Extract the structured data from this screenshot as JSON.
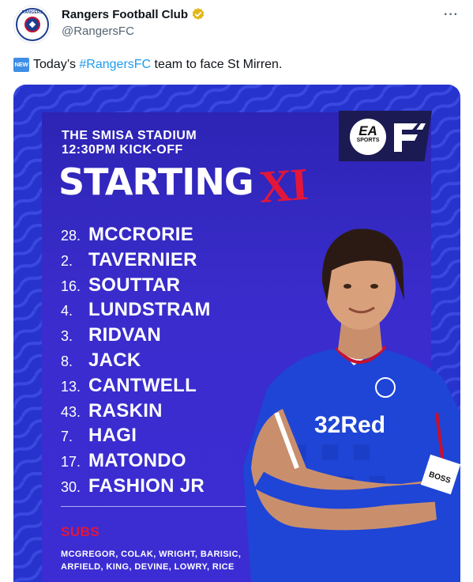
{
  "tweet": {
    "display_name": "Rangers Football Club",
    "handle": "@RangersFC",
    "more_label": "···",
    "avatar_text": "RANGERS",
    "new_badge": "NEW",
    "text_before": "Today’s ",
    "hashtag": "#RangersFC",
    "text_after": " team to face St Mirren."
  },
  "graphic": {
    "stadium": "THE SMISA STADIUM",
    "kickoff": "12:30PM KICK-OFF",
    "starting": "STARTING",
    "xi": "XI",
    "ea_logo": "EA",
    "ea_sports": "SPORTS",
    "shirt_sponsor": "32Red",
    "sleeve_sponsor": "BOSS",
    "players": [
      {
        "num": "28.",
        "name": "MCCRORIE"
      },
      {
        "num": "2.",
        "name": "TAVERNIER"
      },
      {
        "num": "16.",
        "name": "SOUTTAR"
      },
      {
        "num": "4.",
        "name": "LUNDSTRAM"
      },
      {
        "num": "3.",
        "name": "RIDVAN"
      },
      {
        "num": "8.",
        "name": "JACK"
      },
      {
        "num": "13.",
        "name": "CANTWELL"
      },
      {
        "num": "43.",
        "name": "RASKIN"
      },
      {
        "num": "7.",
        "name": "HAGI"
      },
      {
        "num": "17.",
        "name": "MATONDO"
      },
      {
        "num": "30.",
        "name": "FASHION JR"
      }
    ],
    "subs_title": "SUBS",
    "subs_line1": "MCGREGOR, COLAK, WRIGHT, BARISIC,",
    "subs_line2": "ARFIELD, KING, DEVINE, LOWRY, RICE"
  },
  "colors": {
    "accent_red": "#e3163a",
    "panel_blue": "#3a2ccc",
    "link_blue": "#1d9bf0",
    "verified_gold": "#e2b719"
  }
}
